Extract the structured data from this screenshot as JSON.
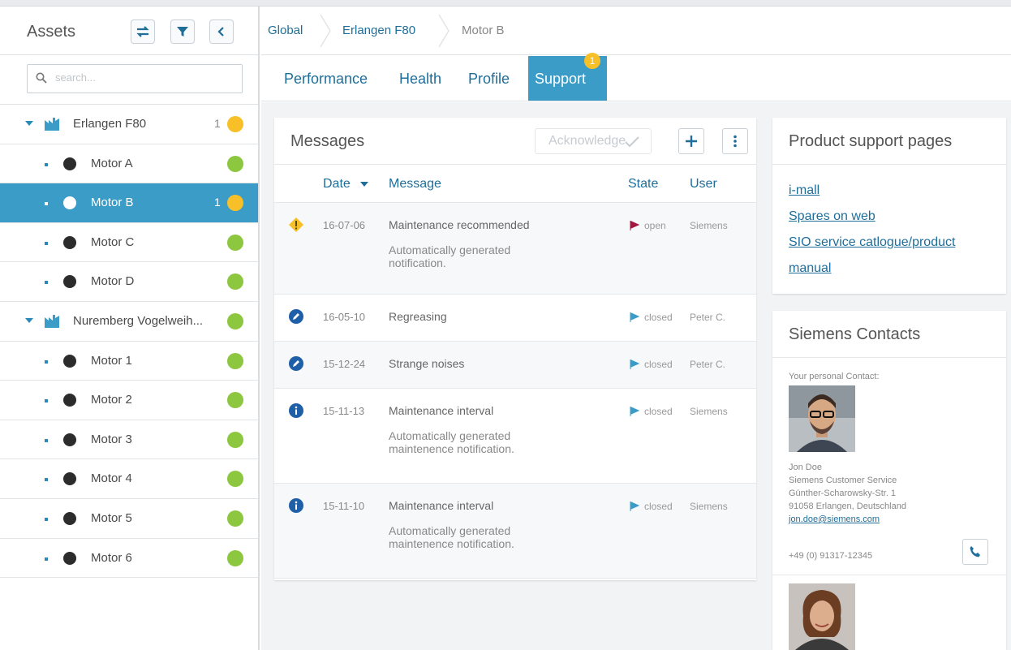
{
  "sidebar": {
    "title": "Assets",
    "search_placeholder": "search...",
    "tree": [
      {
        "level": 1,
        "label": "Erlangen F80",
        "count": "1",
        "status": "yellow"
      },
      {
        "level": 2,
        "label": "Motor A",
        "count": "",
        "status": "green"
      },
      {
        "level": 2,
        "label": "Motor B",
        "count": "1",
        "status": "yellow",
        "selected": true
      },
      {
        "level": 2,
        "label": "Motor C",
        "count": "",
        "status": "green"
      },
      {
        "level": 2,
        "label": "Motor D",
        "count": "",
        "status": "green"
      },
      {
        "level": 1,
        "label": "Nuremberg Vogelweih...",
        "count": "",
        "status": "green"
      },
      {
        "level": 2,
        "label": "Motor 1",
        "count": "",
        "status": "green"
      },
      {
        "level": 2,
        "label": "Motor 2",
        "count": "",
        "status": "green"
      },
      {
        "level": 2,
        "label": "Motor 3",
        "count": "",
        "status": "green"
      },
      {
        "level": 2,
        "label": "Motor 4",
        "count": "",
        "status": "green"
      },
      {
        "level": 2,
        "label": "Motor 5",
        "count": "",
        "status": "green"
      },
      {
        "level": 2,
        "label": "Motor 6",
        "count": "",
        "status": "green"
      }
    ]
  },
  "breadcrumb": [
    "Global",
    "Erlangen F80",
    "Motor B"
  ],
  "tabs": [
    {
      "label": "Performance"
    },
    {
      "label": "Health"
    },
    {
      "label": "Profile"
    },
    {
      "label": "Support",
      "badge": "1",
      "active": true
    }
  ],
  "messages": {
    "title": "Messages",
    "acknowledge_label": "Acknowledge",
    "columns": {
      "date": "Date",
      "message": "Message",
      "state": "State",
      "user": "User"
    },
    "rows": [
      {
        "icon": "warning-icon",
        "date": "16-07-06",
        "message": "Maintenance recommended",
        "sub": "Automatically generated notification.",
        "state": "open",
        "user": "Siemens"
      },
      {
        "icon": "edit-icon",
        "date": "16-05-10",
        "message": "Regreasing",
        "sub": "",
        "state": "closed",
        "user": "Peter C."
      },
      {
        "icon": "edit-icon",
        "date": "15-12-24",
        "message": "Strange noises",
        "sub": "",
        "state": "closed",
        "user": "Peter C."
      },
      {
        "icon": "info-icon",
        "date": "15-11-13",
        "message": "Maintenance interval",
        "sub": "Automatically generated maintenence notification.",
        "state": "closed",
        "user": "Siemens"
      },
      {
        "icon": "info-icon",
        "date": "15-11-10",
        "message": "Maintenance interval",
        "sub": "Automatically generated maintenence notification.",
        "state": "closed",
        "user": "Siemens"
      }
    ]
  },
  "support": {
    "title": "Product support pages",
    "links": [
      "i-mall",
      "Spares on web",
      "SIO service catlogue/product manual"
    ]
  },
  "contacts": {
    "title": "Siemens Contacts",
    "subtitle": "Your personal Contact:",
    "name": "Jon Doe",
    "org": "Siemens Customer Service",
    "street": "Günther-Scharowsky-Str. 1",
    "city": "91058 Erlangen, Deutschland",
    "email": "jon.doe@siemens.com",
    "phone": "+49 (0) 91317-12345"
  },
  "colors": {
    "accent": "#3b9cc8",
    "link": "#1f6e9a",
    "ok": "#8dc63f",
    "warn": "#f7c028",
    "open_flag": "#a3173f",
    "closed_flag": "#3b9cc8"
  }
}
